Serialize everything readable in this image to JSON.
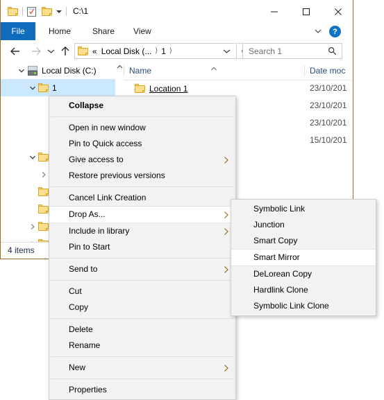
{
  "window": {
    "title": "C:\\1",
    "quick_access": [
      {
        "name": "folder-icon",
        "label": "Folder"
      },
      {
        "name": "properties-icon",
        "label": "Properties"
      },
      {
        "name": "new-folder-icon",
        "label": "New folder"
      },
      {
        "name": "customize-caret-icon",
        "label": "Customize Quick Access Toolbar"
      }
    ],
    "controls": {
      "minimize": "Minimize",
      "maximize": "Maximize",
      "close": "Close"
    }
  },
  "ribbon": {
    "tabs": [
      {
        "label": "File",
        "active": true
      },
      {
        "label": "Home",
        "active": false
      },
      {
        "label": "Share",
        "active": false
      },
      {
        "label": "View",
        "active": false
      }
    ],
    "expand_label": "Expand the Ribbon",
    "help_label": "?"
  },
  "address_bar": {
    "back": "Back",
    "forward": "Forward",
    "recent": "Recent locations",
    "up": "Up",
    "crumbs": [
      "«",
      "Local Disk (...",
      "1"
    ],
    "dropdown": "Previous locations",
    "refresh": "Refresh \"1\" (F5)"
  },
  "search": {
    "placeholder": "Search 1",
    "icon": "search-icon"
  },
  "nav_pane": {
    "items": [
      {
        "label": "Local Disk (C:)",
        "indent": 1,
        "twisty": "expanded",
        "icon": "drive-icon",
        "selected": false
      },
      {
        "label": "1",
        "indent": 2,
        "twisty": "expanded",
        "icon": "folder-icon",
        "selected": true
      },
      {
        "label": "",
        "indent": 3,
        "twisty": "none",
        "icon": "folder-icon",
        "selected": false
      },
      {
        "label": "",
        "indent": 3,
        "twisty": "none",
        "icon": "folder-icon",
        "selected": false
      },
      {
        "label": "",
        "indent": 3,
        "twisty": "none",
        "icon": "folder-icon",
        "selected": false
      },
      {
        "label": "",
        "indent": 2,
        "twisty": "expanded",
        "icon": "folder-icon",
        "selected": false
      },
      {
        "label": "",
        "indent": 3,
        "twisty": "collapsed",
        "icon": "shortcut-folder-icon",
        "selected": false
      },
      {
        "label": "",
        "indent": 2,
        "twisty": "none",
        "icon": "folder-icon",
        "selected": false
      },
      {
        "label": "",
        "indent": 2,
        "twisty": "none",
        "icon": "folder-icon",
        "selected": false
      },
      {
        "label": "",
        "indent": 2,
        "twisty": "collapsed",
        "icon": "folder-icon",
        "selected": false
      },
      {
        "label": "",
        "indent": 2,
        "twisty": "collapsed",
        "icon": "folder-icon",
        "selected": false
      }
    ],
    "scroll_up": "Scroll up"
  },
  "file_list": {
    "columns": [
      {
        "label": "Name",
        "sorted": "asc"
      },
      {
        "label": "Date moc"
      }
    ],
    "rows": [
      {
        "name": "Location 1",
        "date": "23/10/201"
      },
      {
        "name": "",
        "date": "23/10/201"
      },
      {
        "name": "",
        "date": "23/10/201"
      },
      {
        "name": "",
        "date": "15/10/201"
      }
    ]
  },
  "status_bar": {
    "text": "4 items"
  },
  "context_menu": {
    "items": [
      {
        "label": "Collapse",
        "bold": true,
        "submenu": false
      },
      {
        "type": "separator"
      },
      {
        "label": "Open in new window",
        "submenu": false
      },
      {
        "label": "Pin to Quick access",
        "submenu": false
      },
      {
        "label": "Give access to",
        "submenu": true
      },
      {
        "label": "Restore previous versions",
        "submenu": false
      },
      {
        "type": "separator"
      },
      {
        "label": "Cancel Link Creation",
        "submenu": false
      },
      {
        "label": "Drop As...",
        "submenu": true,
        "highlighted": true
      },
      {
        "label": "Include in library",
        "submenu": true
      },
      {
        "label": "Pin to Start",
        "submenu": false
      },
      {
        "type": "separator"
      },
      {
        "label": "Send to",
        "submenu": true
      },
      {
        "type": "separator"
      },
      {
        "label": "Cut",
        "submenu": false
      },
      {
        "label": "Copy",
        "submenu": false
      },
      {
        "type": "separator"
      },
      {
        "label": "Delete",
        "submenu": false
      },
      {
        "label": "Rename",
        "submenu": false
      },
      {
        "type": "separator"
      },
      {
        "label": "New",
        "submenu": true
      },
      {
        "type": "separator"
      },
      {
        "label": "Properties",
        "submenu": false
      }
    ]
  },
  "submenu": {
    "items": [
      {
        "label": "Symbolic Link",
        "highlighted": false
      },
      {
        "label": "Junction",
        "highlighted": false
      },
      {
        "label": "Smart Copy",
        "highlighted": false
      },
      {
        "label": "Smart Mirror",
        "highlighted": true
      },
      {
        "label": "DeLorean Copy",
        "highlighted": false
      },
      {
        "label": "Hardlink Clone",
        "highlighted": false
      },
      {
        "label": "Symbolic Link Clone",
        "highlighted": false
      }
    ]
  },
  "colors": {
    "accent": "#0f6cbd",
    "window_border": "#9a6a24",
    "selection": "#cce8ff",
    "menu_bg": "#f2f2f2",
    "folder": "#fbdf8e"
  }
}
